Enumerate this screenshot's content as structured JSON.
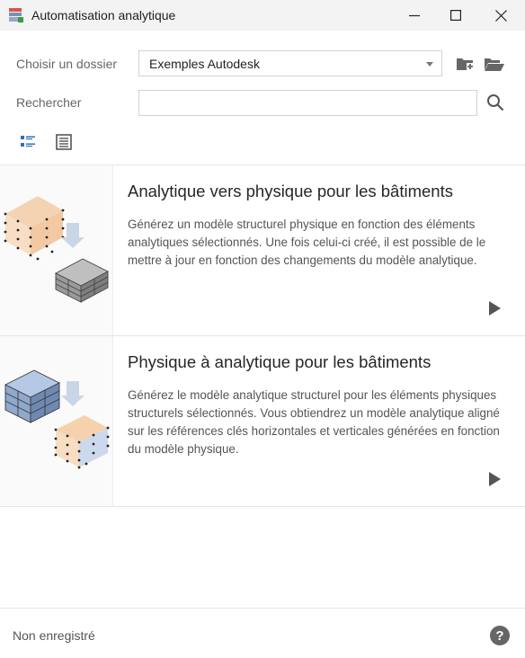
{
  "window": {
    "title": "Automatisation analytique",
    "app_icon": "stacked-layers-icon",
    "controls": [
      "minimize-icon",
      "maximize-icon",
      "close-icon"
    ]
  },
  "folder": {
    "label": "Choisir un dossier",
    "selected": "Exemples Autodesk",
    "actions": [
      "add-folder-icon",
      "open-folder-icon"
    ]
  },
  "search": {
    "label": "Rechercher",
    "value": "",
    "placeholder": ""
  },
  "view_modes": [
    "list-detail-view-icon",
    "list-view-icon"
  ],
  "cards": [
    {
      "title": "Analytique vers physique pour les bâtiments",
      "description": "Générez un modèle structurel physique en fonction des éléments analytiques sélectionnés. Une fois celui-ci créé, il est possible de le mettre à jour en fonction des changements du modèle analytique.",
      "thumbnail": "analytical-to-physical-thumbnail"
    },
    {
      "title": "Physique à analytique pour les bâtiments",
      "description": "Générez le modèle analytique structurel pour les éléments physiques structurels sélectionnés. Vous obtiendrez un modèle analytique aligné sur les références clés horizontales et verticales générées en fonction du modèle physique.",
      "thumbnail": "physical-to-analytical-thumbnail"
    }
  ],
  "footer": {
    "status": "Non enregistré",
    "help_icon": "help-icon"
  },
  "colors": {
    "titlebar": "#f3f3f3",
    "border": "#d2d2d2",
    "accent_orange": "#f3c9a0",
    "accent_blue": "#b5c9e6"
  }
}
